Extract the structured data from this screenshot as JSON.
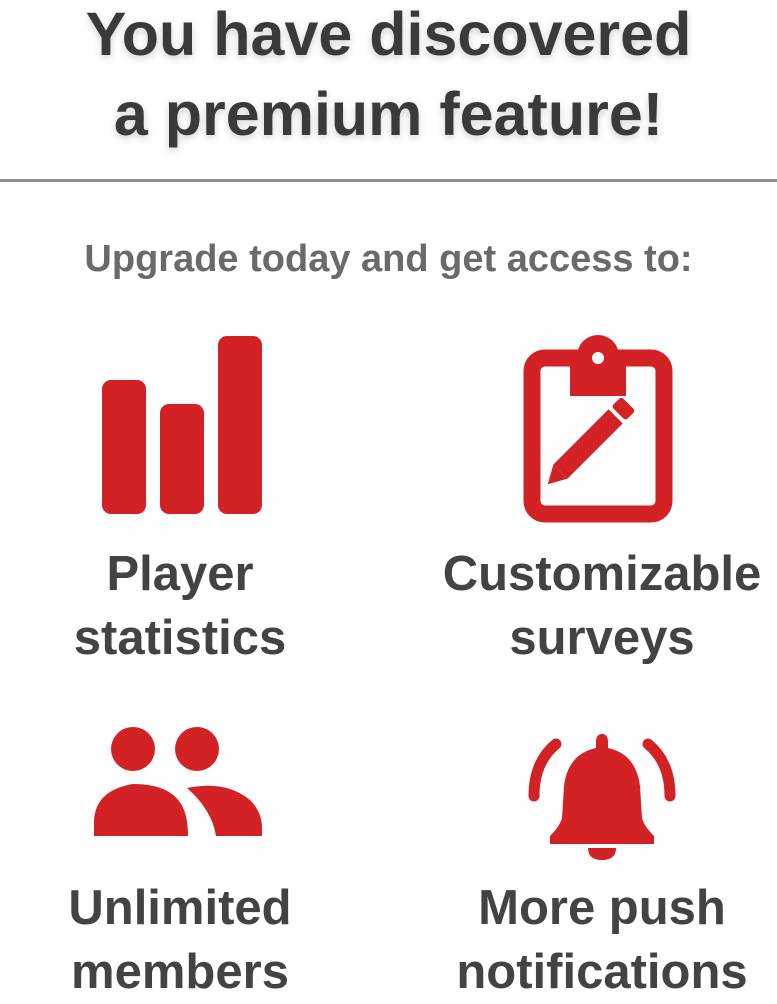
{
  "header": {
    "title_line1": "You have discovered",
    "title_line2": "a premium feature!"
  },
  "subtitle": "Upgrade today and get access to:",
  "colors": {
    "accent": "#d32226",
    "text_dark": "#3a3a3a",
    "text_muted": "#6a6a6a",
    "divider": "#8e8e8e"
  },
  "features": [
    {
      "icon": "bar-chart-icon",
      "line1": "Player",
      "line2": "statistics"
    },
    {
      "icon": "clipboard-edit-icon",
      "line1": "Customizable",
      "line2": "surveys"
    },
    {
      "icon": "users-icon",
      "line1": "Unlimited",
      "line2": "members"
    },
    {
      "icon": "bell-ringing-icon",
      "line1": "More push",
      "line2": "notifications"
    }
  ]
}
